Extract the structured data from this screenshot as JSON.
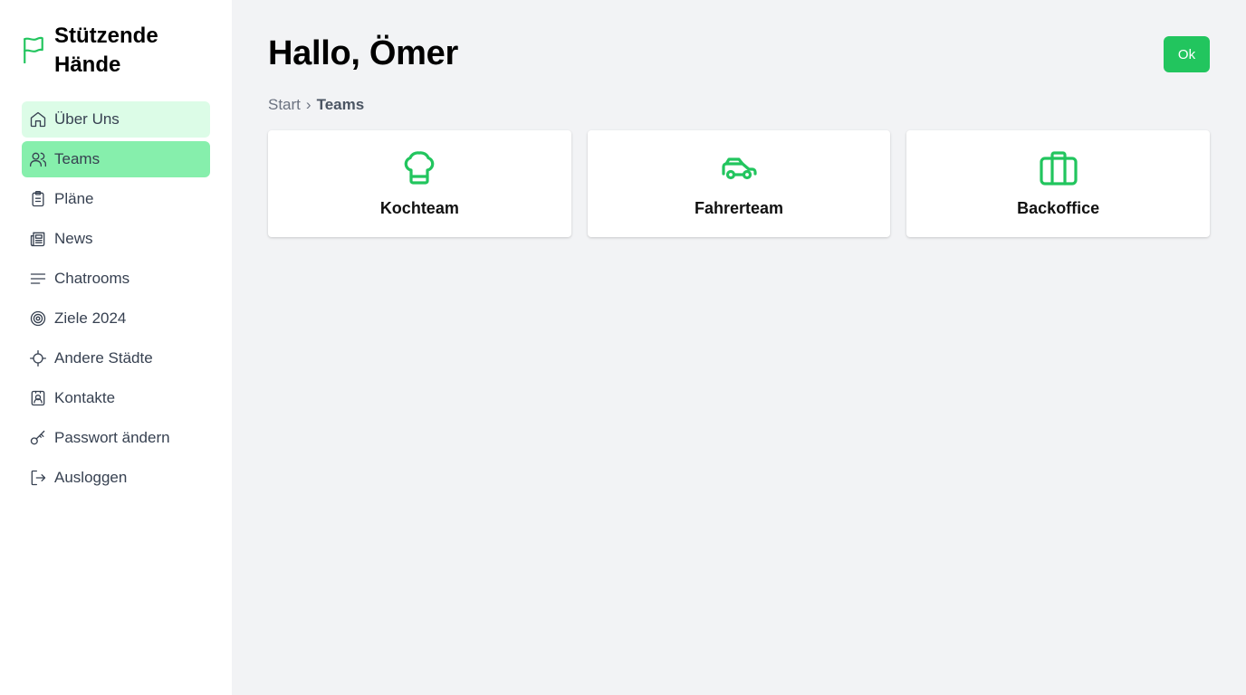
{
  "brand": {
    "title": "Stützende Hände",
    "icon": "flag-icon",
    "accent": "#22c55e"
  },
  "sidebar": {
    "items": [
      {
        "label": "Über Uns",
        "icon": "home-icon",
        "state": "hover"
      },
      {
        "label": "Teams",
        "icon": "users-icon",
        "state": "active"
      },
      {
        "label": "Pläne",
        "icon": "clipboard-icon",
        "state": ""
      },
      {
        "label": "News",
        "icon": "newspaper-icon",
        "state": ""
      },
      {
        "label": "Chatrooms",
        "icon": "menu-lines-icon",
        "state": ""
      },
      {
        "label": "Ziele 2024",
        "icon": "target-icon",
        "state": ""
      },
      {
        "label": "Andere Städte",
        "icon": "crosshair-icon",
        "state": ""
      },
      {
        "label": "Kontakte",
        "icon": "contact-card-icon",
        "state": ""
      },
      {
        "label": "Passwort ändern",
        "icon": "key-icon",
        "state": ""
      },
      {
        "label": "Ausloggen",
        "icon": "logout-icon",
        "state": ""
      }
    ]
  },
  "header": {
    "title": "Hallo, Ömer",
    "ok_label": "Ok"
  },
  "breadcrumb": {
    "root": "Start",
    "separator": "›",
    "current": "Teams"
  },
  "cards": [
    {
      "label": "Kochteam",
      "icon": "chef-hat-icon"
    },
    {
      "label": "Fahrerteam",
      "icon": "car-icon"
    },
    {
      "label": "Backoffice",
      "icon": "briefcase-icon"
    }
  ],
  "colors": {
    "accent": "#22c55e",
    "active_bg": "#86efac",
    "hover_bg": "#dcfce7",
    "page_bg": "#f2f3f5"
  }
}
